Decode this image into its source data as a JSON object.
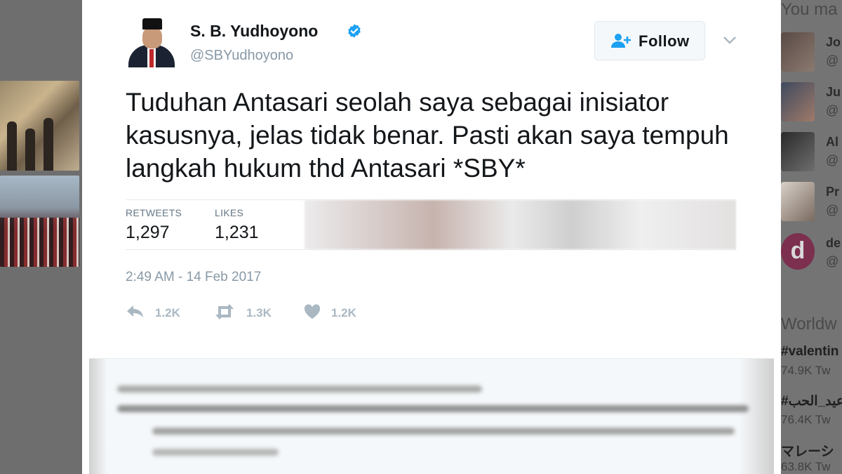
{
  "tweet": {
    "author_name": "S. B. Yudhoyono",
    "author_handle": "@SBYudhoyono",
    "follow_label": "Follow",
    "text": "Tuduhan Antasari seolah saya sebagai inisiator kasusnya, jelas tidak benar. Pasti akan saya tempuh langkah hukum thd Antasari *SBY*",
    "retweets_label": "RETWEETS",
    "retweets_count": "1,297",
    "likes_label": "LIKES",
    "likes_count": "1,231",
    "timestamp": "2:49 AM - 14 Feb 2017",
    "reply_count": "1.2K",
    "retweet_action_count": "1.3K",
    "like_action_count": "1.2K"
  },
  "sidebar": {
    "who_to_follow_title": "You ma",
    "users": [
      {
        "name": "Jo",
        "handle": "@"
      },
      {
        "name": "Ju",
        "handle": "@"
      },
      {
        "name": "Al",
        "handle": "@"
      },
      {
        "name": "Pr",
        "handle": "@"
      },
      {
        "name": "de",
        "handle": "@",
        "avatar_letter": "d"
      }
    ],
    "trends_title": "Worldw",
    "trends": [
      {
        "tag": "#valentin",
        "count": "74.9K Tw"
      },
      {
        "tag": "#عيد_الحب",
        "count": "76.4K Tw"
      },
      {
        "tag": "マレーシ",
        "count": "63.8K Tw"
      }
    ]
  },
  "colors": {
    "verified": "#1da1f2",
    "follow_icon": "#1da1f2",
    "muted": "#8899a6",
    "action_icon": "#aab8c2"
  }
}
